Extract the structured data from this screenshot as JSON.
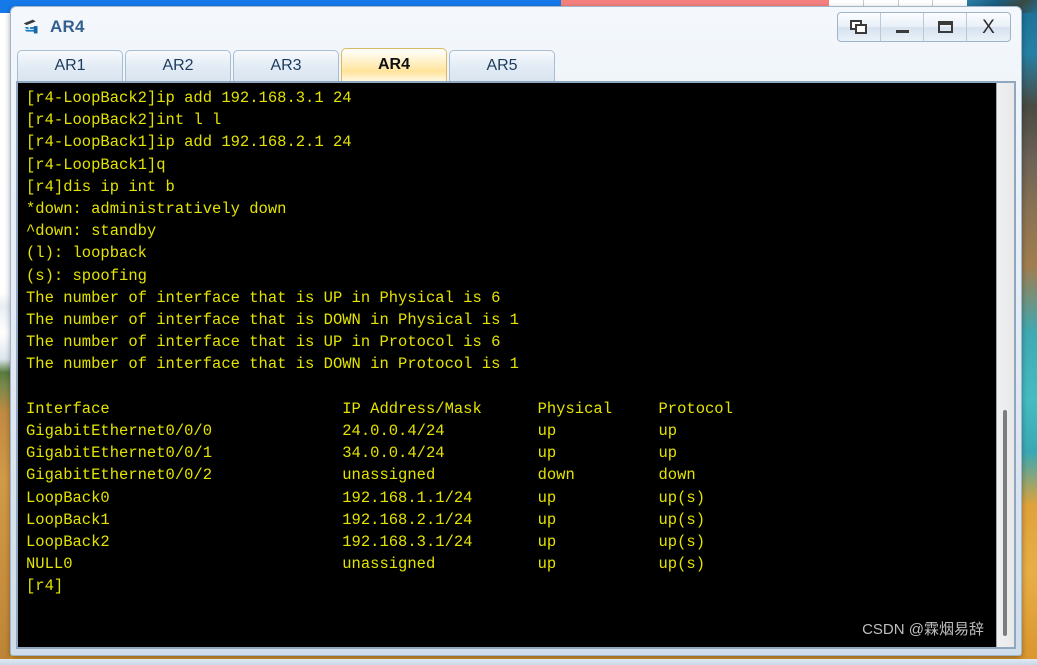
{
  "window": {
    "title": "AR4",
    "icon": "router-icon",
    "controls": [
      {
        "name": "restore-button",
        "glyph": "restore"
      },
      {
        "name": "minimize-button",
        "glyph": "minimize"
      },
      {
        "name": "maximize-button",
        "glyph": "maximize"
      },
      {
        "name": "close-button",
        "glyph": "X"
      }
    ]
  },
  "tabs": [
    {
      "label": "AR1",
      "active": false
    },
    {
      "label": "AR2",
      "active": false
    },
    {
      "label": "AR3",
      "active": false
    },
    {
      "label": "AR4",
      "active": true
    },
    {
      "label": "AR5",
      "active": false
    }
  ],
  "terminal": {
    "foreground_color": "#e3e300",
    "background_color": "#000000",
    "lines": [
      "[r4-LoopBack2]ip add 192.168.3.1 24",
      "[r4-LoopBack2]int l l",
      "[r4-LoopBack1]ip add 192.168.2.1 24",
      "[r4-LoopBack1]q",
      "[r4]dis ip int b",
      "*down: administratively down",
      "^down: standby",
      "(l): loopback",
      "(s): spoofing",
      "The number of interface that is UP in Physical is 6",
      "The number of interface that is DOWN in Physical is 1",
      "The number of interface that is UP in Protocol is 6",
      "The number of interface that is DOWN in Protocol is 1",
      "",
      "Interface                         IP Address/Mask      Physical     Protocol",
      "GigabitEthernet0/0/0              24.0.0.4/24          up           up",
      "GigabitEthernet0/0/1              34.0.0.4/24          up           up",
      "GigabitEthernet0/0/2              unassigned           down         down",
      "LoopBack0                         192.168.1.1/24       up           up(s)",
      "LoopBack1                         192.168.2.1/24       up           up(s)",
      "LoopBack2                         192.168.3.1/24       up           up(s)",
      "NULL0                             unassigned           up           up(s)",
      "[r4]"
    ],
    "legend": {
      "admin_down": "*down: administratively down",
      "standby": "^down: standby",
      "loopback": "(l): loopback",
      "spoofing": "(s): spoofing"
    },
    "summary": {
      "up_physical": "6",
      "down_physical": "1",
      "up_protocol": "6",
      "down_protocol": "1"
    },
    "table": {
      "headers": [
        "Interface",
        "IP Address/Mask",
        "Physical",
        "Protocol"
      ],
      "rows": [
        [
          "GigabitEthernet0/0/0",
          "24.0.0.4/24",
          "up",
          "up"
        ],
        [
          "GigabitEthernet0/0/1",
          "34.0.0.4/24",
          "up",
          "up"
        ],
        [
          "GigabitEthernet0/0/2",
          "unassigned",
          "down",
          "down"
        ],
        [
          "LoopBack0",
          "192.168.1.1/24",
          "up",
          "up(s)"
        ],
        [
          "LoopBack1",
          "192.168.2.1/24",
          "up",
          "up(s)"
        ],
        [
          "LoopBack2",
          "192.168.3.1/24",
          "up",
          "up(s)"
        ],
        [
          "NULL0",
          "unassigned",
          "up",
          "up(s)"
        ]
      ]
    },
    "prompt": "[r4]"
  },
  "watermark": {
    "text": "CSDN @霖烟易辞"
  }
}
